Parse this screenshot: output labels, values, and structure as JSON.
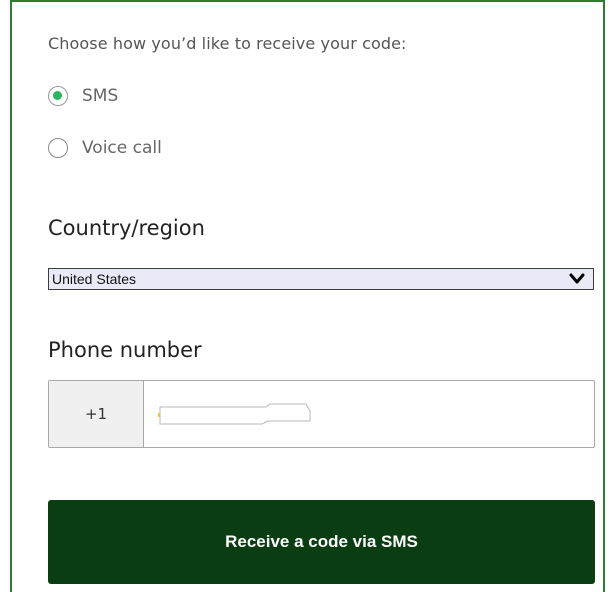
{
  "prompt": "Choose how you’d like to receive your code:",
  "delivery_options": [
    {
      "label": "SMS",
      "selected": true
    },
    {
      "label": "Voice call",
      "selected": false
    }
  ],
  "country": {
    "label": "Country/region",
    "selected_value": "United States"
  },
  "phone": {
    "label": "Phone number",
    "country_code": "+1",
    "value": ""
  },
  "submit_label": "Receive a code via SMS",
  "colors": {
    "frame_border": "#2e7d32",
    "radio_selected": "#2db55d",
    "button_bg": "#0a3d12",
    "select_bg": "#e8eaf8"
  },
  "icons": {
    "select_chevron": "chevron-down-icon"
  }
}
